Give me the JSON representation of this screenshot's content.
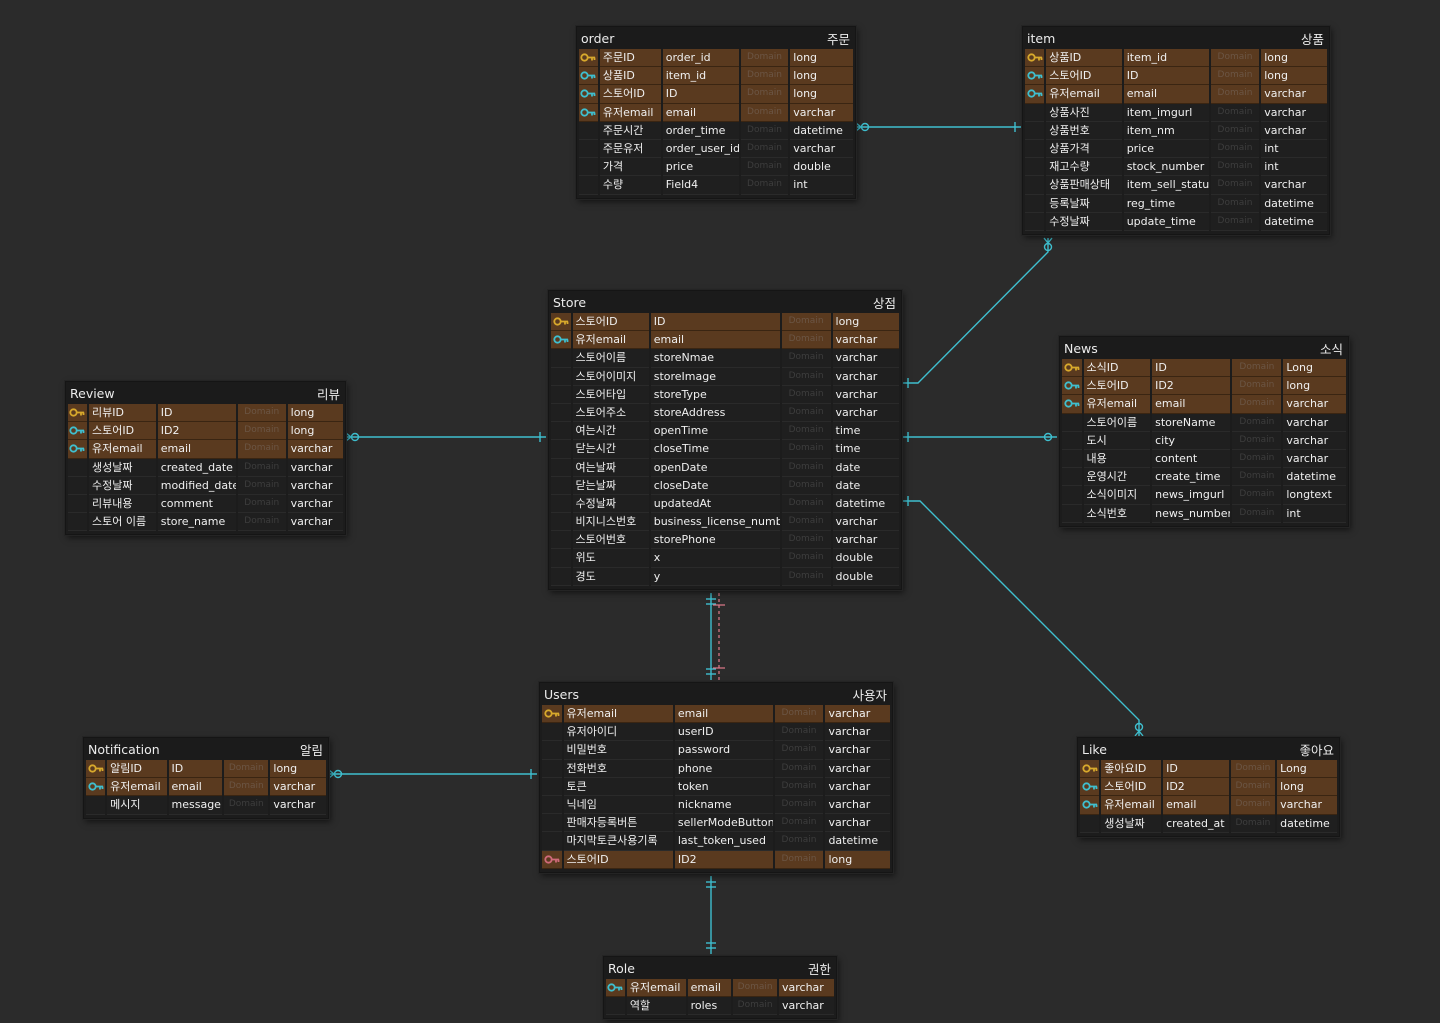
{
  "colors": {
    "background": "#2b2b2b",
    "entity_bg": "#1c1c1c",
    "key_row": "#5a3a1f",
    "plain_row": "#1f1f1f",
    "relation_line": "#3fbfcf",
    "relation_dashed": "#e07a8a",
    "primary_key": "#d8a92c",
    "foreign_key": "#3fbfcf",
    "pf_key": "#d06a7a"
  },
  "entities": [
    {
      "id": "order",
      "title": "order",
      "title_kr": "주문",
      "columns": [
        {
          "kr": "주문ID",
          "name": "order_id",
          "domain": "Domain",
          "type": "long",
          "key": "pk"
        },
        {
          "kr": "상품ID",
          "name": "item_id",
          "domain": "Domain",
          "type": "long",
          "key": "fk"
        },
        {
          "kr": "스토어ID",
          "name": "ID",
          "domain": "Domain",
          "type": "long",
          "key": "fk"
        },
        {
          "kr": "유저email",
          "name": "email",
          "domain": "Domain",
          "type": "varchar",
          "key": "fk"
        },
        {
          "kr": "주문시간",
          "name": "order_time",
          "domain": "Domain",
          "type": "datetime",
          "key": ""
        },
        {
          "kr": "주문유저",
          "name": "order_user_id",
          "domain": "Domain",
          "type": "varchar",
          "key": ""
        },
        {
          "kr": "가격",
          "name": "price",
          "domain": "Domain",
          "type": "double",
          "key": ""
        },
        {
          "kr": "수량",
          "name": "Field4",
          "domain": "Domain",
          "type": "int",
          "key": ""
        }
      ]
    },
    {
      "id": "item",
      "title": "item",
      "title_kr": "상품",
      "columns": [
        {
          "kr": "상품ID",
          "name": "item_id",
          "domain": "Domain",
          "type": "long",
          "key": "pk"
        },
        {
          "kr": "스토어ID",
          "name": "ID",
          "domain": "Domain",
          "type": "long",
          "key": "fk"
        },
        {
          "kr": "유저email",
          "name": "email",
          "domain": "Domain",
          "type": "varchar",
          "key": "fk"
        },
        {
          "kr": "상품사진",
          "name": "item_imgurl",
          "domain": "Domain",
          "type": "varchar",
          "key": ""
        },
        {
          "kr": "상품번호",
          "name": "item_nm",
          "domain": "Domain",
          "type": "varchar",
          "key": ""
        },
        {
          "kr": "상품가격",
          "name": "price",
          "domain": "Domain",
          "type": "int",
          "key": ""
        },
        {
          "kr": "재고수량",
          "name": "stock_number",
          "domain": "Domain",
          "type": "int",
          "key": ""
        },
        {
          "kr": "상품판매상태",
          "name": "item_sell_status",
          "domain": "Domain",
          "type": "varchar",
          "key": ""
        },
        {
          "kr": "등록날짜",
          "name": "reg_time",
          "domain": "Domain",
          "type": "datetime",
          "key": ""
        },
        {
          "kr": "수정날짜",
          "name": "update_time",
          "domain": "Domain",
          "type": "datetime",
          "key": ""
        }
      ]
    },
    {
      "id": "store",
      "title": "Store",
      "title_kr": "상점",
      "columns": [
        {
          "kr": "스토어ID",
          "name": "ID",
          "domain": "Domain",
          "type": "long",
          "key": "pk"
        },
        {
          "kr": "유저email",
          "name": "email",
          "domain": "Domain",
          "type": "varchar",
          "key": "fk"
        },
        {
          "kr": "스토어이름",
          "name": "storeNmae",
          "domain": "Domain",
          "type": "varchar",
          "key": ""
        },
        {
          "kr": "스토어이미지",
          "name": "storeImage",
          "domain": "Domain",
          "type": "varchar",
          "key": ""
        },
        {
          "kr": "스토어타입",
          "name": "storeType",
          "domain": "Domain",
          "type": "varchar",
          "key": ""
        },
        {
          "kr": "스토어주소",
          "name": "storeAddress",
          "domain": "Domain",
          "type": "varchar",
          "key": ""
        },
        {
          "kr": "여는시간",
          "name": "openTime",
          "domain": "Domain",
          "type": "time",
          "key": ""
        },
        {
          "kr": "닫는시간",
          "name": "closeTime",
          "domain": "Domain",
          "type": "time",
          "key": ""
        },
        {
          "kr": "여는날짜",
          "name": "openDate",
          "domain": "Domain",
          "type": "date",
          "key": ""
        },
        {
          "kr": "닫는날짜",
          "name": "closeDate",
          "domain": "Domain",
          "type": "date",
          "key": ""
        },
        {
          "kr": "수정날짜",
          "name": "updatedAt",
          "domain": "Domain",
          "type": "datetime",
          "key": ""
        },
        {
          "kr": "비지니스번호",
          "name": "business_license_number",
          "domain": "Domain",
          "type": "varchar",
          "key": ""
        },
        {
          "kr": "스토어번호",
          "name": "storePhone",
          "domain": "Domain",
          "type": "varchar",
          "key": ""
        },
        {
          "kr": "위도",
          "name": "x",
          "domain": "Domain",
          "type": "double",
          "key": ""
        },
        {
          "kr": "경도",
          "name": "y",
          "domain": "Domain",
          "type": "double",
          "key": ""
        }
      ]
    },
    {
      "id": "news",
      "title": "News",
      "title_kr": "소식",
      "columns": [
        {
          "kr": "소식ID",
          "name": "ID",
          "domain": "Domain",
          "type": "Long",
          "key": "pk"
        },
        {
          "kr": "스토어ID",
          "name": "ID2",
          "domain": "Domain",
          "type": "long",
          "key": "fk"
        },
        {
          "kr": "유저email",
          "name": "email",
          "domain": "Domain",
          "type": "varchar",
          "key": "fk"
        },
        {
          "kr": "스토어이름",
          "name": "storeName",
          "domain": "Domain",
          "type": "varchar",
          "key": ""
        },
        {
          "kr": "도시",
          "name": "city",
          "domain": "Domain",
          "type": "varchar",
          "key": ""
        },
        {
          "kr": "내용",
          "name": "content",
          "domain": "Domain",
          "type": "varchar",
          "key": ""
        },
        {
          "kr": "운영시간",
          "name": "create_time",
          "domain": "Domain",
          "type": "datetime",
          "key": ""
        },
        {
          "kr": "소식이미지",
          "name": "news_imgurl",
          "domain": "Domain",
          "type": "longtext",
          "key": ""
        },
        {
          "kr": "소식번호",
          "name": "news_number",
          "domain": "Domain",
          "type": "int",
          "key": ""
        }
      ]
    },
    {
      "id": "review",
      "title": "Review",
      "title_kr": "리뷰",
      "columns": [
        {
          "kr": "리뷰ID",
          "name": "ID",
          "domain": "Domain",
          "type": "long",
          "key": "pk"
        },
        {
          "kr": "스토어ID",
          "name": "ID2",
          "domain": "Domain",
          "type": "long",
          "key": "fk"
        },
        {
          "kr": "유저email",
          "name": "email",
          "domain": "Domain",
          "type": "varchar",
          "key": "fk"
        },
        {
          "kr": "생성날짜",
          "name": "created_date",
          "domain": "Domain",
          "type": "varchar",
          "key": ""
        },
        {
          "kr": "수정날짜",
          "name": "modified_date",
          "domain": "Domain",
          "type": "varchar",
          "key": ""
        },
        {
          "kr": "리뷰내용",
          "name": "comment",
          "domain": "Domain",
          "type": "varchar",
          "key": ""
        },
        {
          "kr": "스토어 이름",
          "name": "store_name",
          "domain": "Domain",
          "type": "varchar",
          "key": ""
        }
      ]
    },
    {
      "id": "users",
      "title": "Users",
      "title_kr": "사용자",
      "columns": [
        {
          "kr": "유저email",
          "name": "email",
          "domain": "Domain",
          "type": "varchar",
          "key": "pk"
        },
        {
          "kr": "유저아이디",
          "name": "userID",
          "domain": "Domain",
          "type": "varchar",
          "key": ""
        },
        {
          "kr": "비밀번호",
          "name": "password",
          "domain": "Domain",
          "type": "varchar",
          "key": ""
        },
        {
          "kr": "전화번호",
          "name": "phone",
          "domain": "Domain",
          "type": "varchar",
          "key": ""
        },
        {
          "kr": "토큰",
          "name": "token",
          "domain": "Domain",
          "type": "varchar",
          "key": ""
        },
        {
          "kr": "닉네임",
          "name": "nickname",
          "domain": "Domain",
          "type": "varchar",
          "key": ""
        },
        {
          "kr": "판매자등록버튼",
          "name": "sellerModeButton",
          "domain": "Domain",
          "type": "varchar",
          "key": ""
        },
        {
          "kr": "마지막토큰사용기록",
          "name": "last_token_used",
          "domain": "Domain",
          "type": "datetime",
          "key": ""
        },
        {
          "kr": "스토어ID",
          "name": "ID2",
          "domain": "Domain",
          "type": "long",
          "key": "pf"
        }
      ]
    },
    {
      "id": "notification",
      "title": "Notification",
      "title_kr": "알림",
      "columns": [
        {
          "kr": "알림ID",
          "name": "ID",
          "domain": "Domain",
          "type": "long",
          "key": "pk"
        },
        {
          "kr": "유저email",
          "name": "email",
          "domain": "Domain",
          "type": "varchar",
          "key": "fk"
        },
        {
          "kr": "메시지",
          "name": "message",
          "domain": "Domain",
          "type": "varchar",
          "key": ""
        }
      ]
    },
    {
      "id": "like",
      "title": "Like",
      "title_kr": "좋아요",
      "columns": [
        {
          "kr": "좋아요ID",
          "name": "ID",
          "domain": "Domain",
          "type": "Long",
          "key": "pk"
        },
        {
          "kr": "스토어ID",
          "name": "ID2",
          "domain": "Domain",
          "type": "long",
          "key": "fk"
        },
        {
          "kr": "유저email",
          "name": "email",
          "domain": "Domain",
          "type": "varchar",
          "key": "fk"
        },
        {
          "kr": "생성날짜",
          "name": "created_at",
          "domain": "Domain",
          "type": "datetime",
          "key": ""
        }
      ]
    },
    {
      "id": "role",
      "title": "Role",
      "title_kr": "권한",
      "columns": [
        {
          "kr": "유저email",
          "name": "email",
          "domain": "Domain",
          "type": "varchar",
          "key": "fk"
        },
        {
          "kr": "역할",
          "name": "roles",
          "domain": "Domain",
          "type": "varchar",
          "key": ""
        }
      ]
    }
  ],
  "relations": [
    {
      "from": "order",
      "to": "item"
    },
    {
      "from": "store",
      "to": "item"
    },
    {
      "from": "review",
      "to": "store"
    },
    {
      "from": "store",
      "to": "news"
    },
    {
      "from": "store",
      "to": "like"
    },
    {
      "from": "store",
      "to": "users"
    },
    {
      "from": "notification",
      "to": "users"
    },
    {
      "from": "users",
      "to": "role"
    }
  ]
}
